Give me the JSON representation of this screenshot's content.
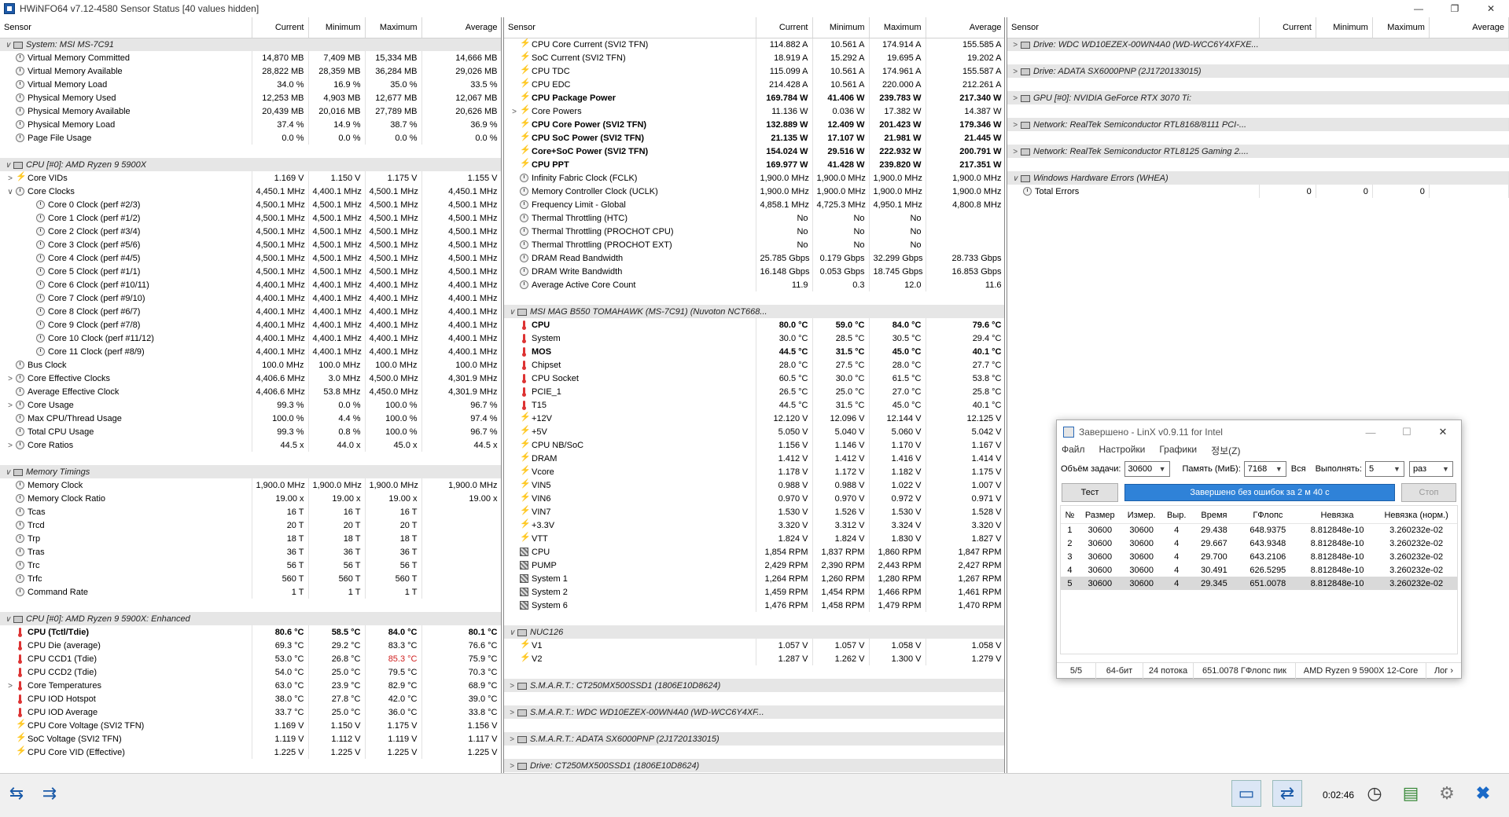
{
  "window": {
    "title": "HWiNFO64 v7.12-4580 Sensor Status [40 values hidden]",
    "controls": [
      "—",
      "❐",
      "✕"
    ]
  },
  "columns": {
    "sensor": "Sensor",
    "current": "Current",
    "minimum": "Minimum",
    "maximum": "Maximum",
    "average": "Average"
  },
  "pane1": [
    {
      "t": "group",
      "label": "System: MSI MS-7C91",
      "tog": "∨"
    },
    {
      "l": "Virtual Memory Committed",
      "ic": "clock",
      "c": "14,870 MB",
      "mn": "7,409 MB",
      "mx": "15,334 MB",
      "av": "14,666 MB"
    },
    {
      "l": "Virtual Memory Available",
      "ic": "clock",
      "c": "28,822 MB",
      "mn": "28,359 MB",
      "mx": "36,284 MB",
      "av": "29,026 MB"
    },
    {
      "l": "Virtual Memory Load",
      "ic": "clock",
      "c": "34.0 %",
      "mn": "16.9 %",
      "mx": "35.0 %",
      "av": "33.5 %"
    },
    {
      "l": "Physical Memory Used",
      "ic": "clock",
      "c": "12,253 MB",
      "mn": "4,903 MB",
      "mx": "12,677 MB",
      "av": "12,067 MB"
    },
    {
      "l": "Physical Memory Available",
      "ic": "clock",
      "c": "20,439 MB",
      "mn": "20,016 MB",
      "mx": "27,789 MB",
      "av": "20,626 MB"
    },
    {
      "l": "Physical Memory Load",
      "ic": "clock",
      "c": "37.4 %",
      "mn": "14.9 %",
      "mx": "38.7 %",
      "av": "36.9 %"
    },
    {
      "l": "Page File Usage",
      "ic": "clock",
      "c": "0.0 %",
      "mn": "0.0 %",
      "mx": "0.0 %",
      "av": "0.0 %"
    },
    {
      "t": "sp"
    },
    {
      "t": "group",
      "label": "CPU [#0]: AMD Ryzen 9 5900X",
      "tog": "∨"
    },
    {
      "l": "Core VIDs",
      "ic": "bolt",
      "tog": ">",
      "c": "1.169 V",
      "mn": "1.150 V",
      "mx": "1.175 V",
      "av": "1.155 V"
    },
    {
      "l": "Core Clocks",
      "ic": "clock",
      "tog": "∨",
      "c": "4,450.1 MHz",
      "mn": "4,400.1 MHz",
      "mx": "4,500.1 MHz",
      "av": "4,450.1 MHz"
    },
    {
      "l": "Core 0 Clock (perf #2/3)",
      "ic": "clock",
      "ind": 2,
      "c": "4,500.1 MHz",
      "mn": "4,500.1 MHz",
      "mx": "4,500.1 MHz",
      "av": "4,500.1 MHz"
    },
    {
      "l": "Core 1 Clock (perf #1/2)",
      "ic": "clock",
      "ind": 2,
      "c": "4,500.1 MHz",
      "mn": "4,500.1 MHz",
      "mx": "4,500.1 MHz",
      "av": "4,500.1 MHz"
    },
    {
      "l": "Core 2 Clock (perf #3/4)",
      "ic": "clock",
      "ind": 2,
      "c": "4,500.1 MHz",
      "mn": "4,500.1 MHz",
      "mx": "4,500.1 MHz",
      "av": "4,500.1 MHz"
    },
    {
      "l": "Core 3 Clock (perf #5/6)",
      "ic": "clock",
      "ind": 2,
      "c": "4,500.1 MHz",
      "mn": "4,500.1 MHz",
      "mx": "4,500.1 MHz",
      "av": "4,500.1 MHz"
    },
    {
      "l": "Core 4 Clock (perf #4/5)",
      "ic": "clock",
      "ind": 2,
      "c": "4,500.1 MHz",
      "mn": "4,500.1 MHz",
      "mx": "4,500.1 MHz",
      "av": "4,500.1 MHz"
    },
    {
      "l": "Core 5 Clock (perf #1/1)",
      "ic": "clock",
      "ind": 2,
      "c": "4,500.1 MHz",
      "mn": "4,500.1 MHz",
      "mx": "4,500.1 MHz",
      "av": "4,500.1 MHz"
    },
    {
      "l": "Core 6 Clock (perf #10/11)",
      "ic": "clock",
      "ind": 2,
      "c": "4,400.1 MHz",
      "mn": "4,400.1 MHz",
      "mx": "4,400.1 MHz",
      "av": "4,400.1 MHz"
    },
    {
      "l": "Core 7 Clock (perf #9/10)",
      "ic": "clock",
      "ind": 2,
      "c": "4,400.1 MHz",
      "mn": "4,400.1 MHz",
      "mx": "4,400.1 MHz",
      "av": "4,400.1 MHz"
    },
    {
      "l": "Core 8 Clock (perf #6/7)",
      "ic": "clock",
      "ind": 2,
      "c": "4,400.1 MHz",
      "mn": "4,400.1 MHz",
      "mx": "4,400.1 MHz",
      "av": "4,400.1 MHz"
    },
    {
      "l": "Core 9 Clock (perf #7/8)",
      "ic": "clock",
      "ind": 2,
      "c": "4,400.1 MHz",
      "mn": "4,400.1 MHz",
      "mx": "4,400.1 MHz",
      "av": "4,400.1 MHz"
    },
    {
      "l": "Core 10 Clock (perf #11/12)",
      "ic": "clock",
      "ind": 2,
      "c": "4,400.1 MHz",
      "mn": "4,400.1 MHz",
      "mx": "4,400.1 MHz",
      "av": "4,400.1 MHz"
    },
    {
      "l": "Core 11 Clock (perf #8/9)",
      "ic": "clock",
      "ind": 2,
      "c": "4,400.1 MHz",
      "mn": "4,400.1 MHz",
      "mx": "4,400.1 MHz",
      "av": "4,400.1 MHz"
    },
    {
      "l": "Bus Clock",
      "ic": "clock",
      "c": "100.0 MHz",
      "mn": "100.0 MHz",
      "mx": "100.0 MHz",
      "av": "100.0 MHz"
    },
    {
      "l": "Core Effective Clocks",
      "ic": "clock",
      "tog": ">",
      "c": "4,406.6 MHz",
      "mn": "3.0 MHz",
      "mx": "4,500.0 MHz",
      "av": "4,301.9 MHz"
    },
    {
      "l": "Average Effective Clock",
      "ic": "clock",
      "c": "4,406.6 MHz",
      "mn": "53.8 MHz",
      "mx": "4,450.0 MHz",
      "av": "4,301.9 MHz"
    },
    {
      "l": "Core Usage",
      "ic": "clock",
      "tog": ">",
      "c": "99.3 %",
      "mn": "0.0 %",
      "mx": "100.0 %",
      "av": "96.7 %"
    },
    {
      "l": "Max CPU/Thread Usage",
      "ic": "clock",
      "c": "100.0 %",
      "mn": "4.4 %",
      "mx": "100.0 %",
      "av": "97.4 %"
    },
    {
      "l": "Total CPU Usage",
      "ic": "clock",
      "c": "99.3 %",
      "mn": "0.8 %",
      "mx": "100.0 %",
      "av": "96.7 %"
    },
    {
      "l": "Core Ratios",
      "ic": "clock",
      "tog": ">",
      "c": "44.5 x",
      "mn": "44.0 x",
      "mx": "45.0 x",
      "av": "44.5 x"
    },
    {
      "t": "sp"
    },
    {
      "t": "group",
      "label": "Memory Timings",
      "tog": "∨"
    },
    {
      "l": "Memory Clock",
      "ic": "clock",
      "c": "1,900.0 MHz",
      "mn": "1,900.0 MHz",
      "mx": "1,900.0 MHz",
      "av": "1,900.0 MHz"
    },
    {
      "l": "Memory Clock Ratio",
      "ic": "clock",
      "c": "19.00 x",
      "mn": "19.00 x",
      "mx": "19.00 x",
      "av": "19.00 x"
    },
    {
      "l": "Tcas",
      "ic": "clock",
      "c": "16 T",
      "mn": "16 T",
      "mx": "16 T",
      "av": ""
    },
    {
      "l": "Trcd",
      "ic": "clock",
      "c": "20 T",
      "mn": "20 T",
      "mx": "20 T",
      "av": ""
    },
    {
      "l": "Trp",
      "ic": "clock",
      "c": "18 T",
      "mn": "18 T",
      "mx": "18 T",
      "av": ""
    },
    {
      "l": "Tras",
      "ic": "clock",
      "c": "36 T",
      "mn": "36 T",
      "mx": "36 T",
      "av": ""
    },
    {
      "l": "Trc",
      "ic": "clock",
      "c": "56 T",
      "mn": "56 T",
      "mx": "56 T",
      "av": ""
    },
    {
      "l": "Trfc",
      "ic": "clock",
      "c": "560 T",
      "mn": "560 T",
      "mx": "560 T",
      "av": ""
    },
    {
      "l": "Command Rate",
      "ic": "clock",
      "c": "1 T",
      "mn": "1 T",
      "mx": "1 T",
      "av": ""
    },
    {
      "t": "sp"
    },
    {
      "t": "group",
      "label": "CPU [#0]: AMD Ryzen 9 5900X: Enhanced",
      "tog": "∨"
    },
    {
      "l": "CPU (Tctl/Tdie)",
      "ic": "therm",
      "b": true,
      "c": "80.6 °C",
      "mn": "58.5 °C",
      "mx": "84.0 °C",
      "av": "80.1 °C"
    },
    {
      "l": "CPU Die (average)",
      "ic": "therm",
      "c": "69.3 °C",
      "mn": "29.2 °C",
      "mx": "83.3 °C",
      "av": "76.6 °C"
    },
    {
      "l": "CPU CCD1 (Tdie)",
      "ic": "therm",
      "c": "53.0 °C",
      "mn": "26.8 °C",
      "mx": "85.3 °C",
      "av": "75.9 °C",
      "mxRed": true
    },
    {
      "l": "CPU CCD2 (Tdie)",
      "ic": "therm",
      "c": "54.0 °C",
      "mn": "25.0 °C",
      "mx": "79.5 °C",
      "av": "70.3 °C"
    },
    {
      "l": "Core Temperatures",
      "ic": "therm",
      "tog": ">",
      "c": "63.0 °C",
      "mn": "23.9 °C",
      "mx": "82.9 °C",
      "av": "68.9 °C"
    },
    {
      "l": "CPU IOD Hotspot",
      "ic": "therm",
      "c": "38.0 °C",
      "mn": "27.8 °C",
      "mx": "42.0 °C",
      "av": "39.0 °C"
    },
    {
      "l": "CPU IOD Average",
      "ic": "therm",
      "c": "33.7 °C",
      "mn": "25.0 °C",
      "mx": "36.0 °C",
      "av": "33.8 °C"
    },
    {
      "l": "CPU Core Voltage (SVI2 TFN)",
      "ic": "bolt",
      "c": "1.169 V",
      "mn": "1.150 V",
      "mx": "1.175 V",
      "av": "1.156 V"
    },
    {
      "l": "SoC Voltage (SVI2 TFN)",
      "ic": "bolt",
      "c": "1.119 V",
      "mn": "1.112 V",
      "mx": "1.119 V",
      "av": "1.117 V"
    },
    {
      "l": "CPU Core VID (Effective)",
      "ic": "bolt",
      "c": "1.225 V",
      "mn": "1.225 V",
      "mx": "1.225 V",
      "av": "1.225 V"
    }
  ],
  "pane2": [
    {
      "l": "CPU Core Current (SVI2 TFN)",
      "ic": "bolt",
      "c": "114.882 A",
      "mn": "10.561 A",
      "mx": "174.914 A",
      "av": "155.585 A"
    },
    {
      "l": "SoC Current (SVI2 TFN)",
      "ic": "bolt",
      "c": "18.919 A",
      "mn": "15.292 A",
      "mx": "19.695 A",
      "av": "19.202 A"
    },
    {
      "l": "CPU TDC",
      "ic": "bolt",
      "c": "115.099 A",
      "mn": "10.561 A",
      "mx": "174.961 A",
      "av": "155.587 A"
    },
    {
      "l": "CPU EDC",
      "ic": "bolt",
      "c": "214.428 A",
      "mn": "10.561 A",
      "mx": "220.000 A",
      "av": "212.261 A"
    },
    {
      "l": "CPU Package Power",
      "ic": "bolt",
      "b": true,
      "c": "169.784 W",
      "mn": "41.406 W",
      "mx": "239.783 W",
      "av": "217.340 W"
    },
    {
      "l": "Core Powers",
      "ic": "bolt",
      "tog": ">",
      "c": "11.136 W",
      "mn": "0.036 W",
      "mx": "17.382 W",
      "av": "14.387 W"
    },
    {
      "l": "CPU Core Power (SVI2 TFN)",
      "ic": "bolt",
      "b": true,
      "c": "132.889 W",
      "mn": "12.409 W",
      "mx": "201.423 W",
      "av": "179.346 W"
    },
    {
      "l": "CPU SoC Power (SVI2 TFN)",
      "ic": "bolt",
      "b": true,
      "c": "21.135 W",
      "mn": "17.107 W",
      "mx": "21.981 W",
      "av": "21.445 W"
    },
    {
      "l": "Core+SoC Power (SVI2 TFN)",
      "ic": "bolt",
      "b": true,
      "c": "154.024 W",
      "mn": "29.516 W",
      "mx": "222.932 W",
      "av": "200.791 W"
    },
    {
      "l": "CPU PPT",
      "ic": "bolt",
      "b": true,
      "c": "169.977 W",
      "mn": "41.428 W",
      "mx": "239.820 W",
      "av": "217.351 W"
    },
    {
      "l": "Infinity Fabric Clock (FCLK)",
      "ic": "clock",
      "c": "1,900.0 MHz",
      "mn": "1,900.0 MHz",
      "mx": "1,900.0 MHz",
      "av": "1,900.0 MHz"
    },
    {
      "l": "Memory Controller Clock (UCLK)",
      "ic": "clock",
      "c": "1,900.0 MHz",
      "mn": "1,900.0 MHz",
      "mx": "1,900.0 MHz",
      "av": "1,900.0 MHz"
    },
    {
      "l": "Frequency Limit - Global",
      "ic": "clock",
      "c": "4,858.1 MHz",
      "mn": "4,725.3 MHz",
      "mx": "4,950.1 MHz",
      "av": "4,800.8 MHz"
    },
    {
      "l": "Thermal Throttling (HTC)",
      "ic": "clock",
      "c": "No",
      "mn": "No",
      "mx": "No",
      "av": ""
    },
    {
      "l": "Thermal Throttling (PROCHOT CPU)",
      "ic": "clock",
      "c": "No",
      "mn": "No",
      "mx": "No",
      "av": ""
    },
    {
      "l": "Thermal Throttling (PROCHOT EXT)",
      "ic": "clock",
      "c": "No",
      "mn": "No",
      "mx": "No",
      "av": ""
    },
    {
      "l": "DRAM Read Bandwidth",
      "ic": "clock",
      "c": "25.785 Gbps",
      "mn": "0.179 Gbps",
      "mx": "32.299 Gbps",
      "av": "28.733 Gbps"
    },
    {
      "l": "DRAM Write Bandwidth",
      "ic": "clock",
      "c": "16.148 Gbps",
      "mn": "0.053 Gbps",
      "mx": "18.745 Gbps",
      "av": "16.853 Gbps"
    },
    {
      "l": "Average Active Core Count",
      "ic": "clock",
      "c": "11.9",
      "mn": "0.3",
      "mx": "12.0",
      "av": "11.6"
    },
    {
      "t": "sp"
    },
    {
      "t": "group",
      "label": "MSI MAG B550 TOMAHAWK (MS-7C91) (Nuvoton NCT668...",
      "tog": "∨"
    },
    {
      "l": "CPU",
      "ic": "therm",
      "b": true,
      "c": "80.0 °C",
      "mn": "59.0 °C",
      "mx": "84.0 °C",
      "av": "79.6 °C"
    },
    {
      "l": "System",
      "ic": "therm",
      "c": "30.0 °C",
      "mn": "28.5 °C",
      "mx": "30.5 °C",
      "av": "29.4 °C"
    },
    {
      "l": "MOS",
      "ic": "therm",
      "b": true,
      "c": "44.5 °C",
      "mn": "31.5 °C",
      "mx": "45.0 °C",
      "av": "40.1 °C"
    },
    {
      "l": "Chipset",
      "ic": "therm",
      "c": "28.0 °C",
      "mn": "27.5 °C",
      "mx": "28.0 °C",
      "av": "27.7 °C"
    },
    {
      "l": "CPU Socket",
      "ic": "therm",
      "c": "60.5 °C",
      "mn": "30.0 °C",
      "mx": "61.5 °C",
      "av": "53.8 °C"
    },
    {
      "l": "PCIE_1",
      "ic": "therm",
      "c": "26.5 °C",
      "mn": "25.0 °C",
      "mx": "27.0 °C",
      "av": "25.8 °C"
    },
    {
      "l": "T15",
      "ic": "therm",
      "c": "44.5 °C",
      "mn": "31.5 °C",
      "mx": "45.0 °C",
      "av": "40.1 °C"
    },
    {
      "l": "+12V",
      "ic": "bolt",
      "c": "12.120 V",
      "mn": "12.096 V",
      "mx": "12.144 V",
      "av": "12.125 V"
    },
    {
      "l": "+5V",
      "ic": "bolt",
      "c": "5.050 V",
      "mn": "5.040 V",
      "mx": "5.060 V",
      "av": "5.042 V"
    },
    {
      "l": "CPU NB/SoC",
      "ic": "bolt",
      "c": "1.156 V",
      "mn": "1.146 V",
      "mx": "1.170 V",
      "av": "1.167 V"
    },
    {
      "l": "DRAM",
      "ic": "bolt",
      "c": "1.412 V",
      "mn": "1.412 V",
      "mx": "1.416 V",
      "av": "1.414 V"
    },
    {
      "l": "Vcore",
      "ic": "bolt",
      "c": "1.178 V",
      "mn": "1.172 V",
      "mx": "1.182 V",
      "av": "1.175 V"
    },
    {
      "l": "VIN5",
      "ic": "bolt",
      "c": "0.988 V",
      "mn": "0.988 V",
      "mx": "1.022 V",
      "av": "1.007 V"
    },
    {
      "l": "VIN6",
      "ic": "bolt",
      "c": "0.970 V",
      "mn": "0.970 V",
      "mx": "0.972 V",
      "av": "0.971 V"
    },
    {
      "l": "VIN7",
      "ic": "bolt",
      "c": "1.530 V",
      "mn": "1.526 V",
      "mx": "1.530 V",
      "av": "1.528 V"
    },
    {
      "l": "+3.3V",
      "ic": "bolt",
      "c": "3.320 V",
      "mn": "3.312 V",
      "mx": "3.324 V",
      "av": "3.320 V"
    },
    {
      "l": "VTT",
      "ic": "bolt",
      "c": "1.824 V",
      "mn": "1.824 V",
      "mx": "1.830 V",
      "av": "1.827 V"
    },
    {
      "l": "CPU",
      "ic": "fan",
      "c": "1,854 RPM",
      "mn": "1,837 RPM",
      "mx": "1,860 RPM",
      "av": "1,847 RPM"
    },
    {
      "l": "PUMP",
      "ic": "fan",
      "c": "2,429 RPM",
      "mn": "2,390 RPM",
      "mx": "2,443 RPM",
      "av": "2,427 RPM"
    },
    {
      "l": "System 1",
      "ic": "fan",
      "c": "1,264 RPM",
      "mn": "1,260 RPM",
      "mx": "1,280 RPM",
      "av": "1,267 RPM"
    },
    {
      "l": "System 2",
      "ic": "fan",
      "c": "1,459 RPM",
      "mn": "1,454 RPM",
      "mx": "1,466 RPM",
      "av": "1,461 RPM"
    },
    {
      "l": "System 6",
      "ic": "fan",
      "c": "1,476 RPM",
      "mn": "1,458 RPM",
      "mx": "1,479 RPM",
      "av": "1,470 RPM"
    },
    {
      "t": "sp"
    },
    {
      "t": "group",
      "label": "NUC126",
      "tog": "∨"
    },
    {
      "l": "V1",
      "ic": "bolt",
      "c": "1.057 V",
      "mn": "1.057 V",
      "mx": "1.058 V",
      "av": "1.058 V"
    },
    {
      "l": "V2",
      "ic": "bolt",
      "c": "1.287 V",
      "mn": "1.262 V",
      "mx": "1.300 V",
      "av": "1.279 V"
    },
    {
      "t": "sp"
    },
    {
      "t": "group",
      "label": "S.M.A.R.T.: CT250MX500SSD1 (1806E10D8624)",
      "tog": ">"
    },
    {
      "t": "sp"
    },
    {
      "t": "group",
      "label": "S.M.A.R.T.: WDC WD10EZEX-00WN4A0 (WD-WCC6Y4XF...",
      "tog": ">"
    },
    {
      "t": "sp"
    },
    {
      "t": "group",
      "label": "S.M.A.R.T.: ADATA SX6000PNP (2J1720133015)",
      "tog": ">"
    },
    {
      "t": "sp"
    },
    {
      "t": "group",
      "label": "Drive: CT250MX500SSD1 (1806E10D8624)",
      "tog": ">"
    }
  ],
  "pane3": [
    {
      "t": "group",
      "label": "Drive: WDC WD10EZEX-00WN4A0 (WD-WCC6Y4XFXE...",
      "tog": ">",
      "chip": true
    },
    {
      "t": "sp"
    },
    {
      "t": "group",
      "label": "Drive: ADATA SX6000PNP (2J1720133015)",
      "tog": ">",
      "chip": true
    },
    {
      "t": "sp"
    },
    {
      "t": "group",
      "label": "GPU [#0]: NVIDIA GeForce RTX 3070 Ti:",
      "tog": ">",
      "chip": true
    },
    {
      "t": "sp"
    },
    {
      "t": "group",
      "label": "Network: RealTek Semiconductor RTL8168/8111 PCI-...",
      "tog": ">",
      "chip": true
    },
    {
      "t": "sp"
    },
    {
      "t": "group",
      "label": "Network: RealTek Semiconductor RTL8125 Gaming 2....",
      "tog": ">",
      "chip": true
    },
    {
      "t": "sp"
    },
    {
      "t": "group",
      "label": "Windows Hardware Errors (WHEA)",
      "tog": "∨",
      "chip": true
    },
    {
      "l": "Total Errors",
      "ic": "clock",
      "c": "0",
      "mn": "0",
      "mx": "0",
      "av": ""
    }
  ],
  "bottom": {
    "timer": "0:02:46",
    "nav_left": "⇆",
    "nav_right": "⇉"
  },
  "linx": {
    "title": "Завершено - LinX v0.9.11 for Intel",
    "controls": [
      "—",
      "☐",
      "✕"
    ],
    "menu": [
      "Файл",
      "Настройки",
      "Графики",
      "정보(Z)"
    ],
    "size_label": "Объём задачи:",
    "size_value": "30600",
    "mem_label": "Память (МиБ):",
    "mem_value": "7168",
    "all_label": "Вся",
    "run_label": "Выполнять:",
    "run_value": "5",
    "run_unit": "раз",
    "test_btn": "Тест",
    "progress_text": "Завершено без ошибок за 2 м 40 с",
    "stop_btn": "Стоп",
    "headers": [
      "№",
      "Размер",
      "Измер.",
      "Выр.",
      "Время",
      "ГФлопс",
      "Невязка",
      "Невязка (норм.)"
    ],
    "rows": [
      [
        "1",
        "30600",
        "30600",
        "4",
        "29.438",
        "648.9375",
        "8.812848e-10",
        "3.260232e-02"
      ],
      [
        "2",
        "30600",
        "30600",
        "4",
        "29.667",
        "643.9348",
        "8.812848e-10",
        "3.260232e-02"
      ],
      [
        "3",
        "30600",
        "30600",
        "4",
        "29.700",
        "643.2106",
        "8.812848e-10",
        "3.260232e-02"
      ],
      [
        "4",
        "30600",
        "30600",
        "4",
        "30.491",
        "626.5295",
        "8.812848e-10",
        "3.260232e-02"
      ],
      [
        "5",
        "30600",
        "30600",
        "4",
        "29.345",
        "651.0078",
        "8.812848e-10",
        "3.260232e-02"
      ]
    ],
    "status": [
      "5/5",
      "64-бит",
      "24 потока",
      "651.0078 ГФлопс пик",
      "AMD Ryzen 9 5900X 12-Core",
      "Лог ›"
    ]
  }
}
